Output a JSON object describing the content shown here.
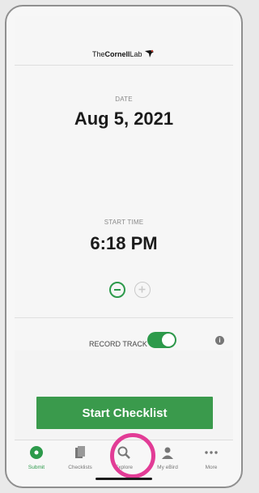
{
  "header": {
    "logo_text_prefix": "The",
    "logo_text_main": "Cornell",
    "logo_text_suffix": "Lab"
  },
  "date": {
    "label": "DATE",
    "value": "Aug 5, 2021"
  },
  "start_time": {
    "label": "START TIME",
    "value": "6:18 PM"
  },
  "record_track": {
    "label": "RECORD TRACK",
    "enabled": true
  },
  "start_button": {
    "label": "Start Checklist"
  },
  "tabs": [
    {
      "label": "Submit",
      "icon": "submit-icon",
      "active": true
    },
    {
      "label": "Checklists",
      "icon": "checklists-icon",
      "active": false
    },
    {
      "label": "Explore",
      "icon": "search-icon",
      "active": false
    },
    {
      "label": "My eBird",
      "icon": "person-icon",
      "active": false
    },
    {
      "label": "More",
      "icon": "more-icon",
      "active": false
    }
  ],
  "colors": {
    "accent": "#2d9a4b",
    "button": "#3a9a4c",
    "highlight": "#e23c96"
  }
}
